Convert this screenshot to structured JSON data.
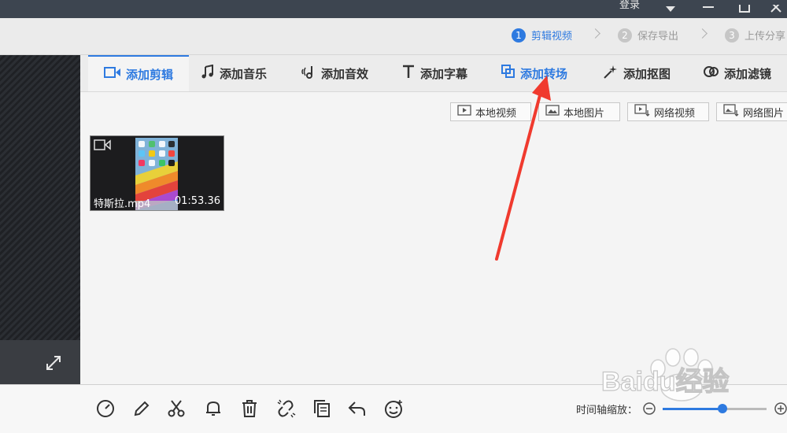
{
  "titlebar": {
    "login": "登录"
  },
  "steps": [
    {
      "num": "1",
      "label": "剪辑视频",
      "active": true
    },
    {
      "num": "2",
      "label": "保存导出",
      "active": false
    },
    {
      "num": "3",
      "label": "上传分享",
      "active": false
    }
  ],
  "tabs": [
    {
      "label": "添加剪辑",
      "icon": "video-camera-icon"
    },
    {
      "label": "添加音乐",
      "icon": "music-note-icon"
    },
    {
      "label": "添加音效",
      "icon": "sound-effect-icon"
    },
    {
      "label": "添加字幕",
      "icon": "text-icon"
    },
    {
      "label": "添加转场",
      "icon": "transition-icon"
    },
    {
      "label": "添加抠图",
      "icon": "magic-wand-icon"
    },
    {
      "label": "添加滤镜",
      "icon": "filter-icon"
    }
  ],
  "sources": [
    {
      "label": "本地视频",
      "icon": "play-box-icon"
    },
    {
      "label": "本地图片",
      "icon": "image-icon"
    },
    {
      "label": "网络视频",
      "icon": "web-video-icon"
    },
    {
      "label": "网络图片",
      "icon": "web-image-icon"
    }
  ],
  "clip": {
    "name": "特斯拉.mp4",
    "duration": "01:53.36"
  },
  "bottom": {
    "tools": [
      "speed-icon",
      "pencil-icon",
      "scissors-icon",
      "bell-icon",
      "trash-icon",
      "unlink-icon",
      "copy-icon",
      "undo-icon",
      "emoji-icon"
    ],
    "zoom_label": "时间轴缩放："
  },
  "watermark": {
    "text": "Baidu经验"
  },
  "colors": {
    "accent": "#2e7ae0",
    "annotation_arrow": "#f03a2e"
  }
}
